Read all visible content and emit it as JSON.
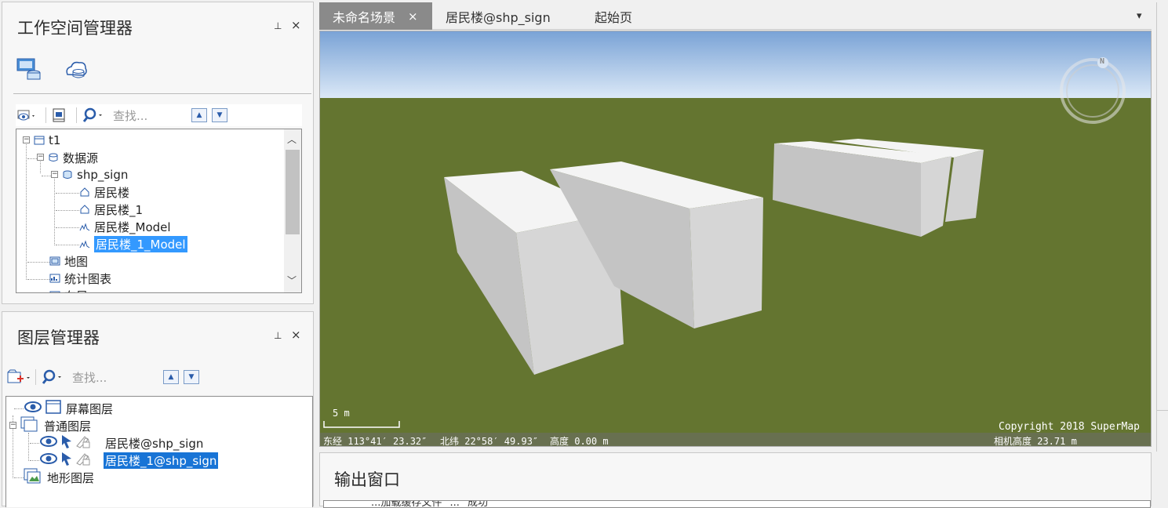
{
  "workspace": {
    "title": "工作空间管理器",
    "pin": "⊥",
    "close": "×",
    "search_placeholder": "查找...",
    "tree": {
      "root": "t1",
      "datasources": "数据源",
      "datasource": "shp_sign",
      "datasets": [
        "居民楼",
        "居民楼_1",
        "居民楼_Model",
        "居民楼_1_Model"
      ],
      "maps": "地图",
      "charts": "统计图表",
      "layouts": "布局"
    }
  },
  "layers": {
    "title": "图层管理器",
    "pin": "⊥",
    "close": "×",
    "search_placeholder": "查找...",
    "screen_layers": "屏幕图层",
    "normal_layers": "普通图层",
    "layer_items": [
      "居民楼@shp_sign",
      "居民楼_1@shp_sign"
    ],
    "terrain_layers": "地形图层"
  },
  "tabs": {
    "items": [
      "未命名场景",
      "居民楼@shp_sign",
      "起始页"
    ],
    "active_close": "×",
    "dropdown": "▾"
  },
  "scene": {
    "scale_label": "5 m",
    "copyright": "Copyright 2018 SuperMap",
    "longitude": "东经 113°41′ 23.32″",
    "latitude": "北纬 22°58′ 49.93″",
    "height": "高度 0.00 m",
    "camera_height": "相机高度 23.71 m",
    "compass_letter": "N",
    "colors": {
      "sky_top": "#7aa3d6",
      "sky_bottom": "#dce9f7",
      "ground": "#647530"
    }
  },
  "output": {
    "title": "输出窗口",
    "log_partial": "...加载缓存文件 \"...\" 成功"
  }
}
